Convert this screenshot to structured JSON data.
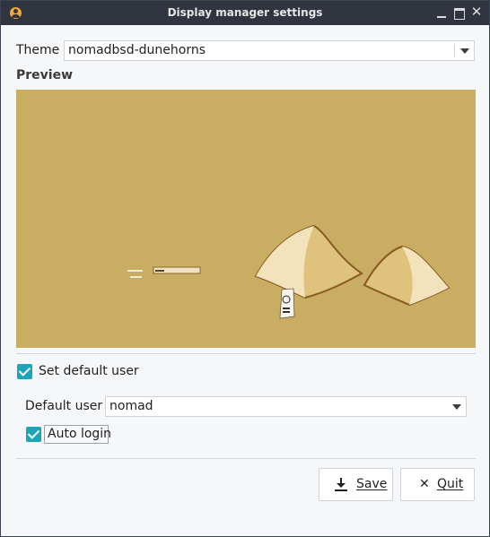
{
  "window": {
    "title": "Display manager settings",
    "icons": [
      "user-app-icon",
      "minimize-icon",
      "maximize-icon",
      "close-icon"
    ]
  },
  "theme": {
    "label": "Theme",
    "selected": "nomadbsd-dunehorns"
  },
  "preview": {
    "heading": "Preview"
  },
  "default_user": {
    "checkbox_label": "Set default user",
    "checked": true,
    "field_label": "Default user",
    "selected": "nomad"
  },
  "autologin": {
    "label": "Auto login",
    "checked": true
  },
  "buttons": {
    "save": "Save",
    "quit": "Quit"
  },
  "colors": {
    "accent": "#1aa6b7",
    "titlebar": "#2f343f",
    "sand": "#c9ad62"
  }
}
